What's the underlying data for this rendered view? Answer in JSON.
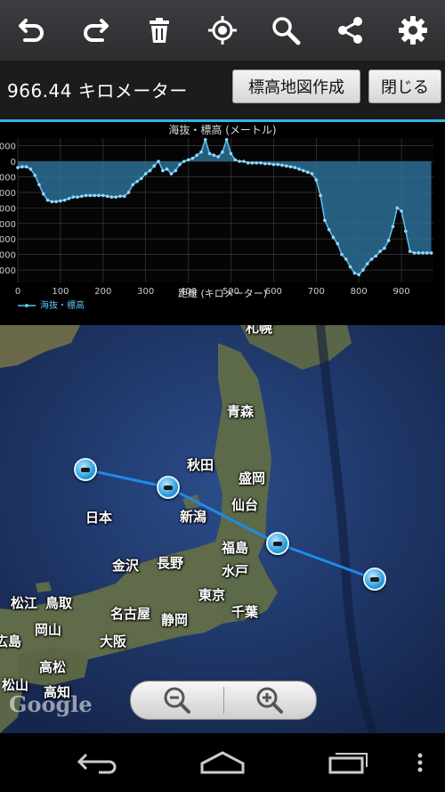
{
  "toolbar": {
    "icons": [
      "undo-icon",
      "redo-icon",
      "trash-icon",
      "locate-icon",
      "search-icon",
      "share-icon",
      "gear-icon"
    ]
  },
  "info": {
    "distance": "966.44 キロメーター",
    "elevation_button": "標高地図作成",
    "close_button": "閉じる"
  },
  "chart_data": {
    "type": "area",
    "title": "海抜・標高 (メートル)",
    "xlabel": "距離 (キロメーター)",
    "legend": "海抜・標高",
    "legend_position": "bottom-left",
    "grid": true,
    "xlim": [
      0,
      975
    ],
    "ylim": [
      -7800,
      1500
    ],
    "x_ticks": [
      0,
      100,
      200,
      300,
      400,
      500,
      600,
      700,
      800,
      900
    ],
    "y_ticks": [
      1000,
      0,
      -1000,
      -2000,
      -3000,
      -4000,
      -5000,
      -6000,
      -7000
    ],
    "y_tick_labels": [
      "1000",
      "0",
      "1000",
      "2000",
      "3000",
      "4000",
      "5000",
      "6000",
      "7000"
    ],
    "x": [
      0,
      10,
      20,
      30,
      40,
      50,
      60,
      70,
      80,
      90,
      100,
      110,
      120,
      130,
      140,
      150,
      160,
      170,
      180,
      190,
      200,
      210,
      220,
      230,
      240,
      250,
      260,
      270,
      280,
      290,
      300,
      310,
      320,
      330,
      340,
      350,
      360,
      370,
      380,
      390,
      400,
      410,
      420,
      430,
      440,
      450,
      460,
      470,
      480,
      490,
      500,
      510,
      520,
      530,
      540,
      550,
      560,
      570,
      580,
      590,
      600,
      610,
      620,
      630,
      640,
      650,
      660,
      670,
      680,
      690,
      700,
      710,
      720,
      730,
      740,
      750,
      760,
      770,
      780,
      790,
      800,
      810,
      820,
      830,
      840,
      850,
      860,
      870,
      880,
      890,
      900,
      910,
      920,
      930,
      940,
      950,
      960,
      970
    ],
    "series": [
      {
        "name": "海抜・標高",
        "values": [
          -400,
          -350,
          -350,
          -500,
          -900,
          -1500,
          -2100,
          -2500,
          -2600,
          -2600,
          -2550,
          -2500,
          -2400,
          -2300,
          -2300,
          -2250,
          -2200,
          -2200,
          -2200,
          -2200,
          -2200,
          -2250,
          -2300,
          -2300,
          -2250,
          -2250,
          -2000,
          -1500,
          -1300,
          -1100,
          -800,
          -600,
          -300,
          0,
          -600,
          -500,
          -800,
          -600,
          -200,
          0,
          100,
          200,
          400,
          600,
          1400,
          500,
          400,
          300,
          600,
          1400,
          500,
          100,
          0,
          0,
          -100,
          -100,
          -100,
          -100,
          -150,
          -150,
          -200,
          -200,
          -250,
          -300,
          -350,
          -400,
          -500,
          -600,
          -700,
          -800,
          -1200,
          -2200,
          -3800,
          -4400,
          -4900,
          -5300,
          -6000,
          -6300,
          -6800,
          -7200,
          -7300,
          -7000,
          -6600,
          -6300,
          -6100,
          -5800,
          -5600,
          -5100,
          -4200,
          -3000,
          -3200,
          -4500,
          -5800,
          -5900,
          -5900,
          -5900,
          -5900,
          -5900
        ]
      }
    ]
  },
  "map": {
    "cities": [
      "札幌",
      "青森",
      "秋田",
      "盛岡",
      "仙台",
      "新潟",
      "福島",
      "金沢",
      "長野",
      "水戸",
      "東京",
      "千葉",
      "名古屋",
      "静岡",
      "大阪",
      "松江",
      "鳥取",
      "岡山",
      "広島",
      "高松",
      "松山",
      "高知"
    ],
    "country_label": "日本",
    "logo": "Google"
  },
  "zoom": {
    "icons": [
      "zoom-out-icon",
      "zoom-in-icon"
    ]
  },
  "navbar": {
    "icons": [
      "back-icon",
      "home-icon",
      "recent-apps-icon",
      "overflow-menu-icon"
    ]
  }
}
